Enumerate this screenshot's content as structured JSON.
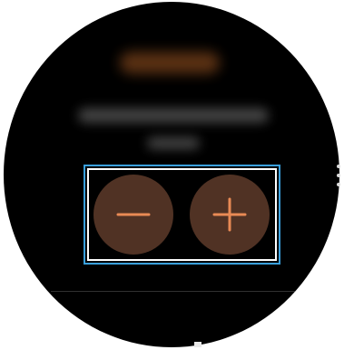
{
  "screen": {
    "title_obscured": true,
    "description_obscured": true
  },
  "controls": {
    "decrease": {
      "icon": "minus-icon",
      "symbol": "−"
    },
    "increase": {
      "icon": "plus-icon",
      "symbol": "+"
    }
  },
  "side_menu": {
    "icon": "more-options-icon"
  },
  "colors": {
    "face_background": "#000000",
    "button_fill": "#503224",
    "button_glyph": "#e98a55",
    "highlight_outer": "#3aa0dc",
    "highlight_inner": "#ffffff"
  }
}
